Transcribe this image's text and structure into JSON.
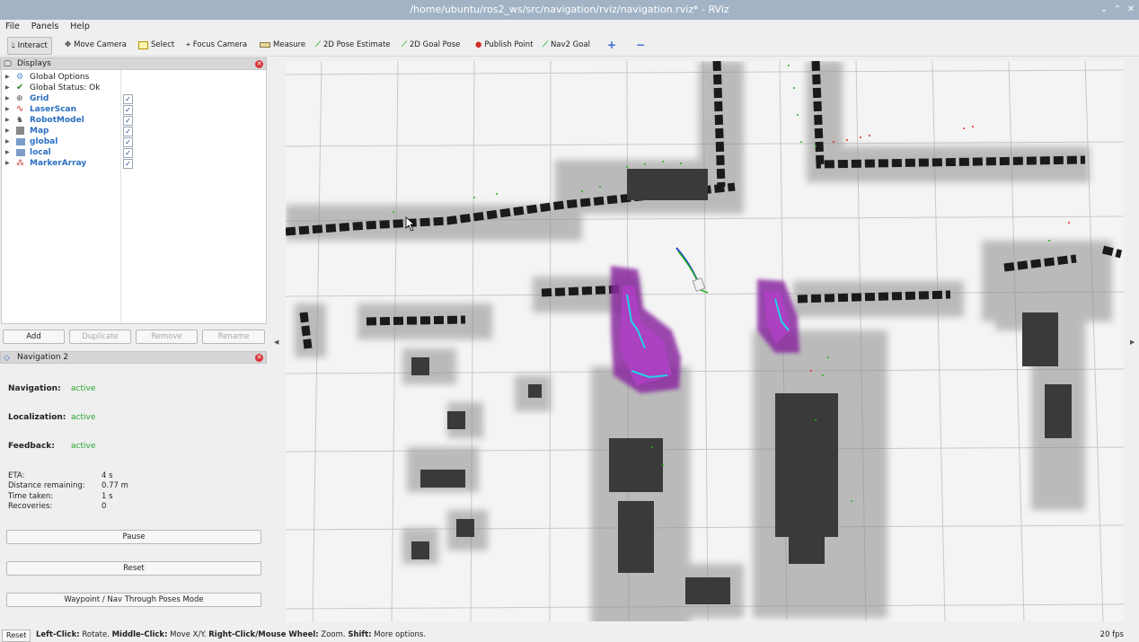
{
  "window": {
    "title": "/home/ubuntu/ros2_ws/src/navigation/rviz/navigation.rviz* - RViz"
  },
  "menu": [
    "File",
    "Panels",
    "Help"
  ],
  "toolbar": [
    {
      "label": "Interact",
      "icon": "cursor-icon"
    },
    {
      "label": "Move Camera",
      "icon": "move-camera-icon"
    },
    {
      "label": "Select",
      "icon": "select-icon"
    },
    {
      "label": "Focus Camera",
      "icon": "focus-camera-icon"
    },
    {
      "label": "Measure",
      "icon": "ruler-icon"
    },
    {
      "label": "2D Pose Estimate",
      "icon": "pose-arrow-icon"
    },
    {
      "label": "2D Goal Pose",
      "icon": "goal-arrow-icon"
    },
    {
      "label": "Publish Point",
      "icon": "map-pin-icon"
    },
    {
      "label": "Nav2 Goal",
      "icon": "nav-goal-arrow-icon"
    }
  ],
  "displays": {
    "title": "Displays",
    "items": [
      {
        "label": "Global Options",
        "icon": "gear-icon",
        "plugin": false
      },
      {
        "label": "Global Status: Ok",
        "icon": "checkmark-icon",
        "plugin": false
      },
      {
        "label": "Grid",
        "icon": "grid-icon",
        "plugin": true,
        "checked": "✓"
      },
      {
        "label": "LaserScan",
        "icon": "laser-scan-icon",
        "plugin": true,
        "checked": "✓"
      },
      {
        "label": "RobotModel",
        "icon": "robot-icon",
        "plugin": true,
        "checked": "✓"
      },
      {
        "label": "Map",
        "icon": "map-icon",
        "plugin": true,
        "checked": "✓"
      },
      {
        "label": "global",
        "icon": "folder-icon",
        "plugin": true,
        "checked": "✓"
      },
      {
        "label": "local",
        "icon": "folder-icon",
        "plugin": true,
        "checked": "✓"
      },
      {
        "label": "MarkerArray",
        "icon": "marker-icon",
        "plugin": true,
        "checked": "✓"
      }
    ],
    "buttons": {
      "add": "Add",
      "duplicate": "Duplicate",
      "remove": "Remove",
      "rename": "Rename"
    }
  },
  "nav2": {
    "title": "Navigation 2",
    "navigation_label": "Navigation:",
    "navigation_value": "active",
    "localization_label": "Localization:",
    "localization_value": "active",
    "feedback_label": "Feedback:",
    "feedback_value": "active",
    "eta_label": "ETA:",
    "eta_value": "4 s",
    "distance_label": "Distance remaining:",
    "distance_value": "0.77 m",
    "time_label": "Time taken:",
    "time_value": "1 s",
    "recoveries_label": "Recoveries:",
    "recoveries_value": "0",
    "pause_button": "Pause",
    "reset_button": "Reset",
    "waypoint_button": "Waypoint / Nav Through Poses Mode"
  },
  "status": {
    "reset": "Reset",
    "left_click": "Left-Click:",
    "left_click_action": " Rotate. ",
    "middle_click": "Middle-Click:",
    "middle_click_action": " Move X/Y. ",
    "right_click": "Right-Click/Mouse Wheel:",
    "right_click_action": " Zoom. ",
    "shift": "Shift:",
    "shift_action": " More options.",
    "fps": "20 fps"
  },
  "colors": {
    "active_green": "#26a62f",
    "plugin_blue": "#2a6fc2",
    "costmap_purple": "#a040b0"
  }
}
